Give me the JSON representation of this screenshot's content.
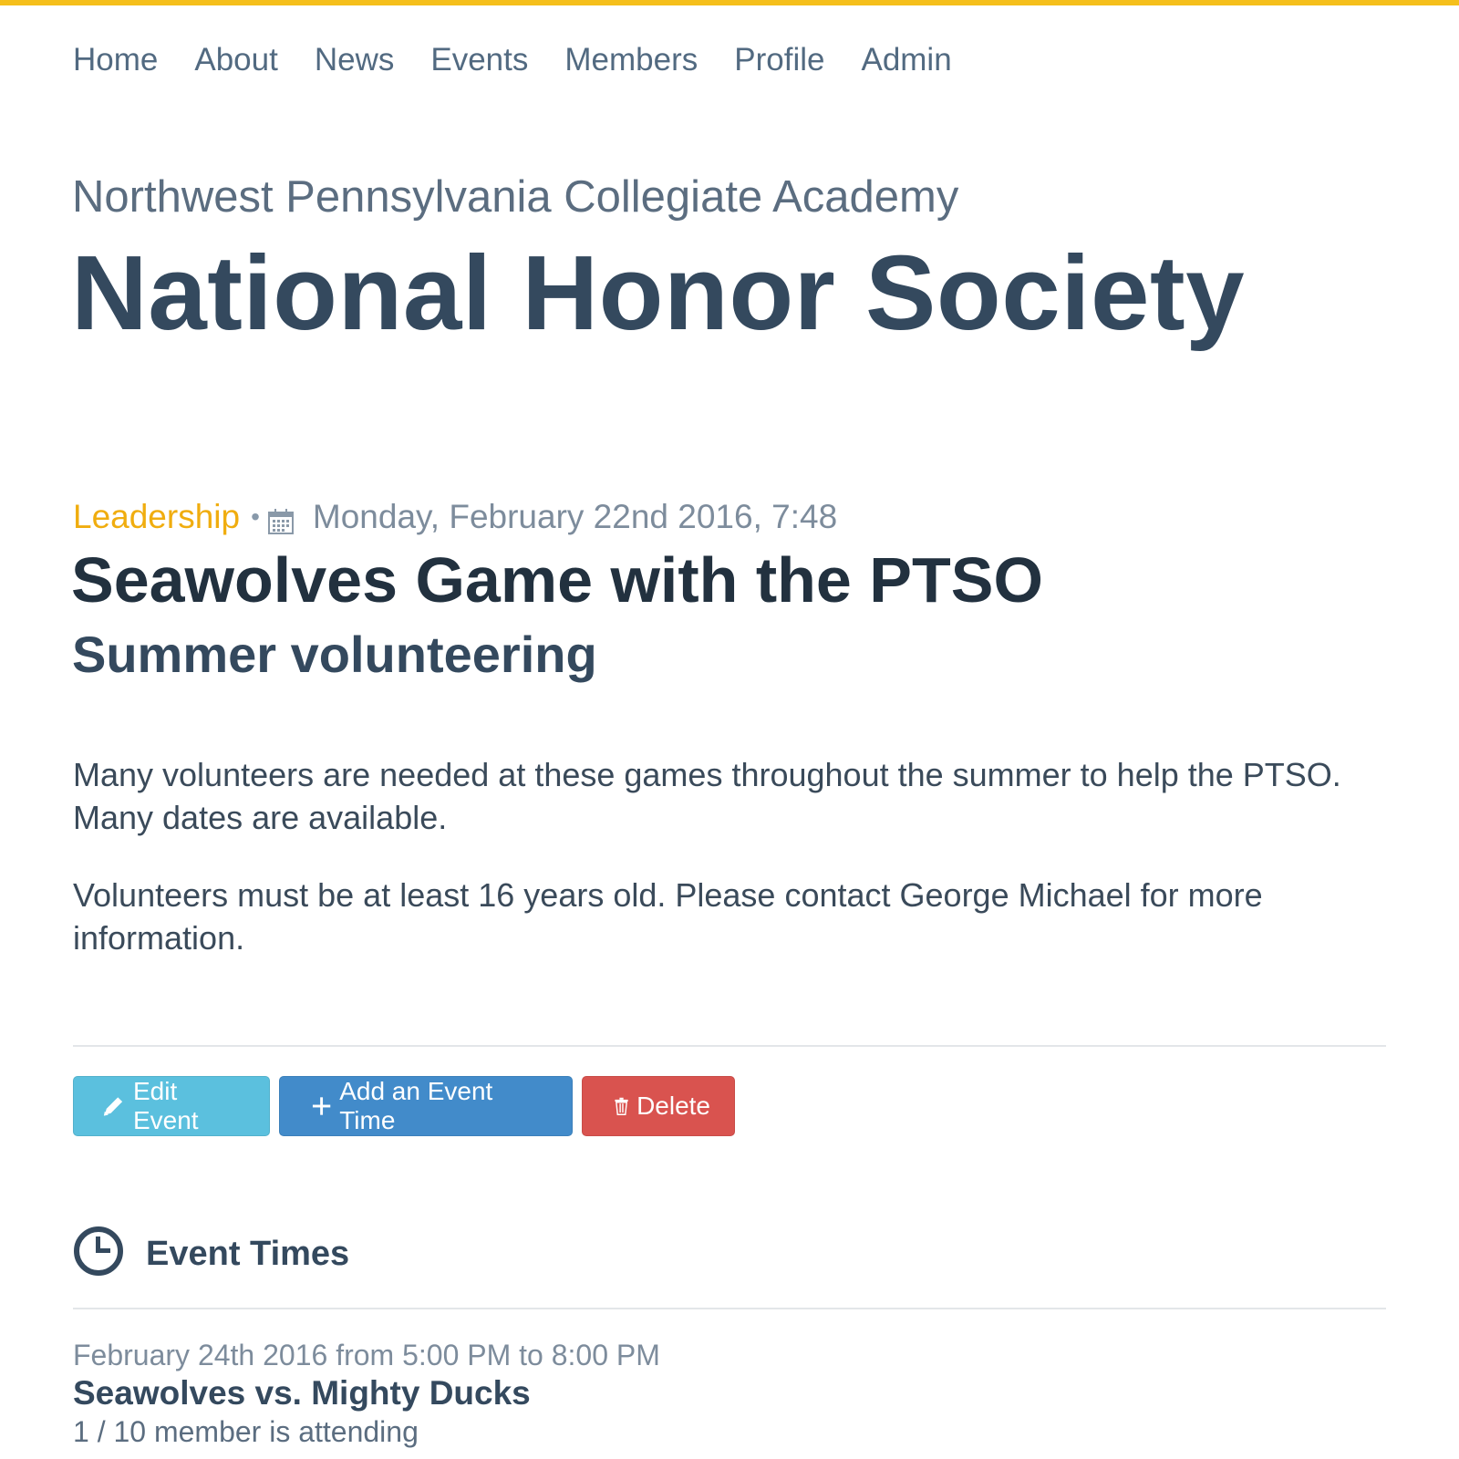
{
  "colors": {
    "accent": "#f5bf1b",
    "category": "#f0ad0f",
    "text": "#34495e",
    "info": "#5bc0de",
    "primary": "#428bca",
    "danger": "#d9534f"
  },
  "nav": [
    "Home",
    "About",
    "News",
    "Events",
    "Members",
    "Profile",
    "Admin"
  ],
  "header": {
    "school": "Northwest Pennsylvania Collegiate Academy",
    "society": "National Honor Society"
  },
  "event": {
    "category": "Leadership",
    "separator": "•",
    "date_icon": "calendar-icon",
    "date": "Monday, February 22nd 2016, 7:48",
    "title": "Seawolves Game with the PTSO",
    "subtitle": "Summer volunteering",
    "paragraphs": [
      "Many volunteers are needed at these games throughout the summer to help the PTSO. Many dates are available.",
      "Volunteers must be at least 16 years old. Please contact George Michael for more information."
    ]
  },
  "actions": {
    "edit": {
      "label": "Edit Event",
      "icon": "pencil-icon"
    },
    "add": {
      "label": "Add an Event Time",
      "icon": "plus-icon"
    },
    "delete": {
      "label": "Delete",
      "icon": "trash-icon"
    }
  },
  "times": {
    "heading": "Event Times",
    "heading_icon": "clock-icon",
    "items": [
      {
        "when": "February 24th 2016 from 5:00 PM to 8:00 PM",
        "title": "Seawolves vs. Mighty Ducks",
        "attendance": "1 / 10 member is attending"
      }
    ]
  }
}
